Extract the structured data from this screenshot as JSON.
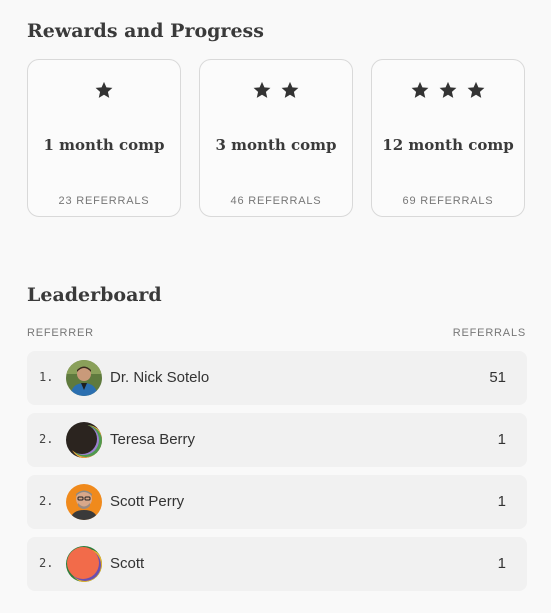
{
  "rewards": {
    "title": "Rewards and Progress",
    "tiers": [
      {
        "stars": 1,
        "name": "1 month comp",
        "requirement": "23 REFERRALS"
      },
      {
        "stars": 2,
        "name": "3 month comp",
        "requirement": "46 REFERRALS"
      },
      {
        "stars": 3,
        "name": "12 month comp",
        "requirement": "69 REFERRALS"
      }
    ]
  },
  "leaderboard": {
    "title": "Leaderboard",
    "col_referrer": "REFERRER",
    "col_referrals": "REFERRALS",
    "rows": [
      {
        "rank": "1.",
        "name": "Dr. Nick Sotelo",
        "referrals": "51"
      },
      {
        "rank": "2.",
        "name": "Teresa Berry",
        "referrals": "1"
      },
      {
        "rank": "2.",
        "name": "Scott Perry",
        "referrals": "1"
      },
      {
        "rank": "2.",
        "name": "Scott",
        "referrals": "1"
      }
    ]
  },
  "icons": {
    "star": "star-icon",
    "avatar": "avatar"
  },
  "colors": {
    "star": "#333333",
    "row_bg": "#f1f1f1",
    "card_border": "#d9d9d9"
  }
}
